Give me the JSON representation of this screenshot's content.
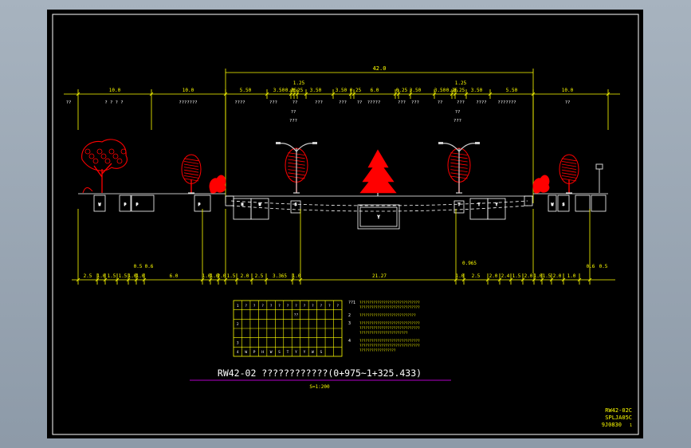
{
  "drawing": {
    "title": "RW42-02 ????????????(0+975~1+325.433)",
    "scale": "S=1:200",
    "code_lines": [
      "RW42-02C",
      "SPLJA05C",
      "9J0830",
      "1"
    ]
  },
  "colors": {
    "frame_outer": "#0b0b0b",
    "frame_inner": "#ffffff",
    "dimension": "#ffff00",
    "tree": "#ff0000",
    "text": "#ffffff",
    "title_underline": "#b000c8"
  },
  "top_dims": {
    "overall": "42.0",
    "segments": [
      "10.0",
      "10.0",
      "5.50",
      "3.50",
      "0.25",
      "0.25",
      "3.50",
      "3.50",
      "0.25",
      "6.0",
      "0.25",
      "3.50",
      "3.50",
      "0.25",
      "0.25",
      "3.50",
      "5.50",
      "10.0"
    ],
    "gaps_above": [
      "1.25",
      "1.25"
    ],
    "lane_labels": [
      "??",
      "? ? ? ?",
      "???????",
      "????",
      "???",
      "??",
      "???",
      "???",
      "??",
      "?????",
      "???",
      "???",
      "??",
      "???",
      "????",
      "???????",
      "??"
    ],
    "sub_labels": [
      "??",
      "???",
      "??",
      "???"
    ]
  },
  "bottom_dims": {
    "callouts": [
      "0.5",
      "0.6",
      "0.965",
      "0.6",
      "0.5"
    ],
    "segments": [
      "2.5",
      "1.0",
      "1.5",
      "1.5",
      "1.0",
      "1.0",
      "6.0",
      "1.0",
      "1.0",
      "2.0",
      "1.5",
      "2.0",
      "2.5",
      "3.365",
      "1.0",
      "21.27",
      "1.0",
      "2.5",
      "2.0",
      "2.4",
      "1.5",
      "2.0",
      "1.0",
      "1.5",
      "2.0",
      "1.0"
    ]
  },
  "pipe_labels": [
    "W",
    "P",
    "P",
    "P",
    "H",
    "W",
    "S",
    "T",
    "T",
    "Y",
    "W",
    "S"
  ],
  "culvert_label": "Y",
  "legend_table": {
    "rows": [
      [
        "1",
        "?",
        "?",
        "?",
        "?",
        "?",
        "?",
        "?",
        "?",
        "?",
        "?",
        "?",
        "?"
      ],
      [
        "",
        "",
        "",
        "",
        "",
        "",
        "",
        "??",
        "",
        "",
        "",
        "",
        ""
      ],
      [
        "2",
        "",
        "",
        "",
        "",
        "",
        "",
        "",
        "",
        "",
        "",
        "",
        ""
      ],
      [
        "",
        "",
        "",
        "",
        "",
        "",
        "",
        "",
        "",
        "",
        "",
        "",
        ""
      ],
      [
        "3",
        "",
        "",
        "",
        "",
        "",
        "",
        "",
        "",
        "",
        "",
        "",
        ""
      ],
      [
        "4",
        "W",
        "P",
        "H",
        "W",
        "S",
        "T",
        "Y",
        "Y",
        "W",
        "S",
        "",
        ""
      ]
    ]
  },
  "notes": [
    {
      "num": "??1",
      "lines": [
        "??????????????????????????????",
        "??????????????????????????????"
      ]
    },
    {
      "num": "2",
      "lines": [
        "????????????????????????????"
      ]
    },
    {
      "num": "3",
      "lines": [
        "??????????????????????????????",
        "??????????????????????????????",
        "????????????????????????"
      ]
    },
    {
      "num": "4",
      "lines": [
        "??????????????????????????????",
        "??????????????????????????????",
        "??????????????????"
      ]
    }
  ]
}
